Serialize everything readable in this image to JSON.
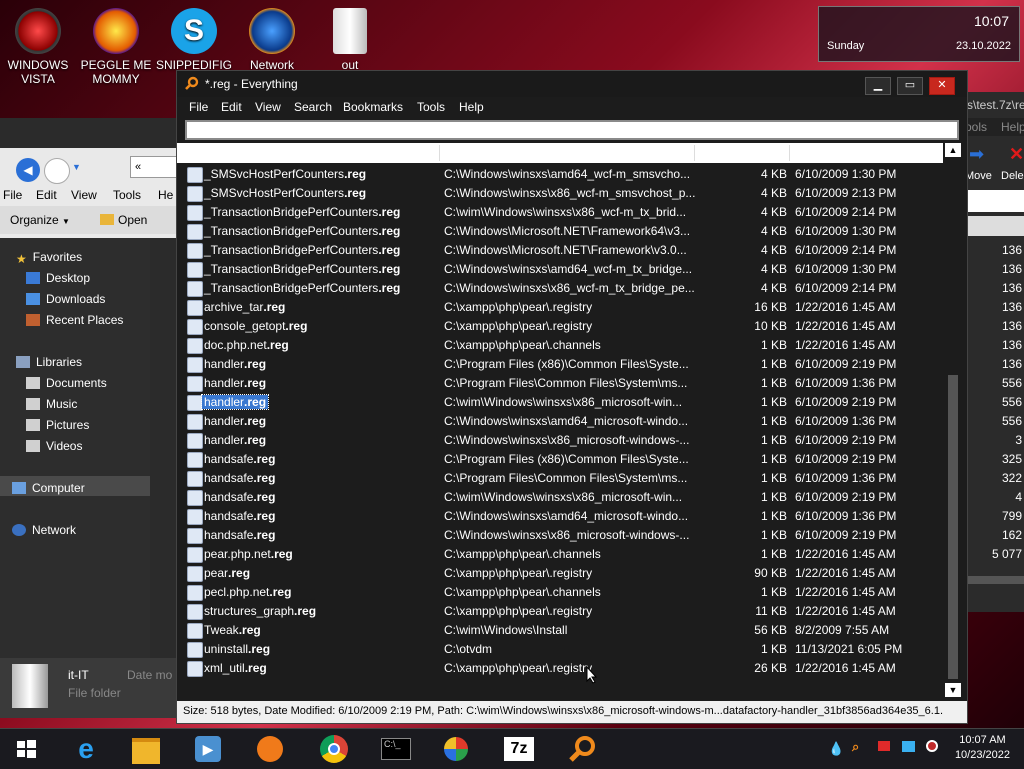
{
  "desktop": {
    "icons": [
      {
        "label": "WINDOWS\nVISTA",
        "name": "windows-vista-icon"
      },
      {
        "label": "PEGGLE ME\nMOMMY",
        "name": "peggle-icon"
      },
      {
        "label": "SNIPPEDIFIG\nGA...",
        "name": "skype-icon"
      },
      {
        "label": "Network",
        "name": "network-icon"
      },
      {
        "label": "out",
        "name": "folder-icon"
      }
    ]
  },
  "clock": {
    "time": "10:07",
    "day": "Sunday",
    "date": "23.10.2022"
  },
  "explorer": {
    "menu": [
      "File",
      "Edit",
      "View",
      "Tools",
      "He"
    ],
    "organize": "Organize",
    "open": "Open",
    "nav": [
      "Favorites",
      "Desktop",
      "Downloads",
      "Recent Places",
      "Libraries",
      "Documents",
      "Music",
      "Pictures",
      "Videos",
      "Computer",
      "Network"
    ],
    "bottom_name": "it-IT",
    "bottom_type": "File folder",
    "bottom_date": "Date mo"
  },
  "bgright": {
    "title": "s\\test.7z\\re",
    "tools": "ools",
    "help": "Help",
    "move": "Move",
    "delete": "Dele",
    "numbers": [
      "136",
      "136",
      "136",
      "136",
      "136",
      "136",
      "136",
      "556",
      "556",
      "556",
      "3",
      "325",
      "322",
      "4",
      "799",
      "162",
      "5 077"
    ]
  },
  "window": {
    "title": "*.reg - Everything",
    "menu": [
      "File",
      "Edit",
      "View",
      "Search",
      "Bookmarks",
      "Tools",
      "Help"
    ],
    "search_value": "",
    "status": "Size: 518 bytes, Date Modified: 6/10/2009 2:19 PM, Path: C:\\wim\\Windows\\winsxs\\x86_microsoft-windows-m...datafactory-handler_31bf3856ad364e35_6.1."
  },
  "rows": [
    {
      "base": "_SMSvcHostPerfCounters",
      "ext": ".reg",
      "path": "C:\\Windows\\winsxs\\amd64_wcf-m_smsvcho...",
      "size": "4 KB",
      "date": "6/10/2009 1:30 PM"
    },
    {
      "base": "_SMSvcHostPerfCounters",
      "ext": ".reg",
      "path": "C:\\Windows\\winsxs\\x86_wcf-m_smsvchost_p...",
      "size": "4 KB",
      "date": "6/10/2009 2:13 PM"
    },
    {
      "base": "_TransactionBridgePerfCounters",
      "ext": ".reg",
      "path": "C:\\wim\\Windows\\winsxs\\x86_wcf-m_tx_brid...",
      "size": "4 KB",
      "date": "6/10/2009 2:14 PM"
    },
    {
      "base": "_TransactionBridgePerfCounters",
      "ext": ".reg",
      "path": "C:\\Windows\\Microsoft.NET\\Framework64\\v3...",
      "size": "4 KB",
      "date": "6/10/2009 1:30 PM"
    },
    {
      "base": "_TransactionBridgePerfCounters",
      "ext": ".reg",
      "path": "C:\\Windows\\Microsoft.NET\\Framework\\v3.0...",
      "size": "4 KB",
      "date": "6/10/2009 2:14 PM"
    },
    {
      "base": "_TransactionBridgePerfCounters",
      "ext": ".reg",
      "path": "C:\\Windows\\winsxs\\amd64_wcf-m_tx_bridge...",
      "size": "4 KB",
      "date": "6/10/2009 1:30 PM"
    },
    {
      "base": "_TransactionBridgePerfCounters",
      "ext": ".reg",
      "path": "C:\\Windows\\winsxs\\x86_wcf-m_tx_bridge_pe...",
      "size": "4 KB",
      "date": "6/10/2009 2:14 PM"
    },
    {
      "base": "archive_tar",
      "ext": ".reg",
      "path": "C:\\xampp\\php\\pear\\.registry",
      "size": "16 KB",
      "date": "1/22/2016 1:45 AM"
    },
    {
      "base": "console_getopt",
      "ext": ".reg",
      "path": "C:\\xampp\\php\\pear\\.registry",
      "size": "10 KB",
      "date": "1/22/2016 1:45 AM"
    },
    {
      "base": "doc.php.net",
      "ext": ".reg",
      "path": "C:\\xampp\\php\\pear\\.channels",
      "size": "1 KB",
      "date": "1/22/2016 1:45 AM"
    },
    {
      "base": "handler",
      "ext": ".reg",
      "path": "C:\\Program Files (x86)\\Common Files\\Syste...",
      "size": "1 KB",
      "date": "6/10/2009 2:19 PM"
    },
    {
      "base": "handler",
      "ext": ".reg",
      "path": "C:\\Program Files\\Common Files\\System\\ms...",
      "size": "1 KB",
      "date": "6/10/2009 1:36 PM"
    },
    {
      "base": "handler",
      "ext": ".reg",
      "path": "C:\\wim\\Windows\\winsxs\\x86_microsoft-win...",
      "size": "1 KB",
      "date": "6/10/2009 2:19 PM",
      "selected": true
    },
    {
      "base": "handler",
      "ext": ".reg",
      "path": "C:\\Windows\\winsxs\\amd64_microsoft-windo...",
      "size": "1 KB",
      "date": "6/10/2009 1:36 PM"
    },
    {
      "base": "handler",
      "ext": ".reg",
      "path": "C:\\Windows\\winsxs\\x86_microsoft-windows-...",
      "size": "1 KB",
      "date": "6/10/2009 2:19 PM"
    },
    {
      "base": "handsafe",
      "ext": ".reg",
      "path": "C:\\Program Files (x86)\\Common Files\\Syste...",
      "size": "1 KB",
      "date": "6/10/2009 2:19 PM"
    },
    {
      "base": "handsafe",
      "ext": ".reg",
      "path": "C:\\Program Files\\Common Files\\System\\ms...",
      "size": "1 KB",
      "date": "6/10/2009 1:36 PM"
    },
    {
      "base": "handsafe",
      "ext": ".reg",
      "path": "C:\\wim\\Windows\\winsxs\\x86_microsoft-win...",
      "size": "1 KB",
      "date": "6/10/2009 2:19 PM"
    },
    {
      "base": "handsafe",
      "ext": ".reg",
      "path": "C:\\Windows\\winsxs\\amd64_microsoft-windo...",
      "size": "1 KB",
      "date": "6/10/2009 1:36 PM"
    },
    {
      "base": "handsafe",
      "ext": ".reg",
      "path": "C:\\Windows\\winsxs\\x86_microsoft-windows-...",
      "size": "1 KB",
      "date": "6/10/2009 2:19 PM"
    },
    {
      "base": "pear.php.net",
      "ext": ".reg",
      "path": "C:\\xampp\\php\\pear\\.channels",
      "size": "1 KB",
      "date": "1/22/2016 1:45 AM"
    },
    {
      "base": "pear",
      "ext": ".reg",
      "path": "C:\\xampp\\php\\pear\\.registry",
      "size": "90 KB",
      "date": "1/22/2016 1:45 AM"
    },
    {
      "base": "pecl.php.net",
      "ext": ".reg",
      "path": "C:\\xampp\\php\\pear\\.channels",
      "size": "1 KB",
      "date": "1/22/2016 1:45 AM"
    },
    {
      "base": "structures_graph",
      "ext": ".reg",
      "path": "C:\\xampp\\php\\pear\\.registry",
      "size": "11 KB",
      "date": "1/22/2016 1:45 AM"
    },
    {
      "base": "Tweak",
      "ext": ".reg",
      "path": "C:\\wim\\Windows\\Install",
      "size": "56 KB",
      "date": "8/2/2009 7:55 AM"
    },
    {
      "base": "uninstall",
      "ext": ".reg",
      "path": "C:\\otvdm",
      "size": "1 KB",
      "date": "11/13/2021 6:05 PM"
    },
    {
      "base": "xml_util",
      "ext": ".reg",
      "path": "C:\\xampp\\php\\pear\\.registry",
      "size": "26 KB",
      "date": "1/22/2016 1:45 AM"
    }
  ],
  "taskbar": {
    "apps": [
      "start-icon",
      "internet-explorer-icon",
      "file-explorer-icon",
      "media-player-icon",
      "uc-browser-icon",
      "chrome-icon",
      "command-prompt-icon",
      "windows-media-center-icon",
      "7zip-icon",
      "everything-search-icon"
    ],
    "time": "10:07 AM",
    "date": "10/23/2022"
  },
  "colors": {
    "selection": "#3a78d0",
    "close": "#c8281e",
    "everything_orange": "#f08a1c"
  }
}
